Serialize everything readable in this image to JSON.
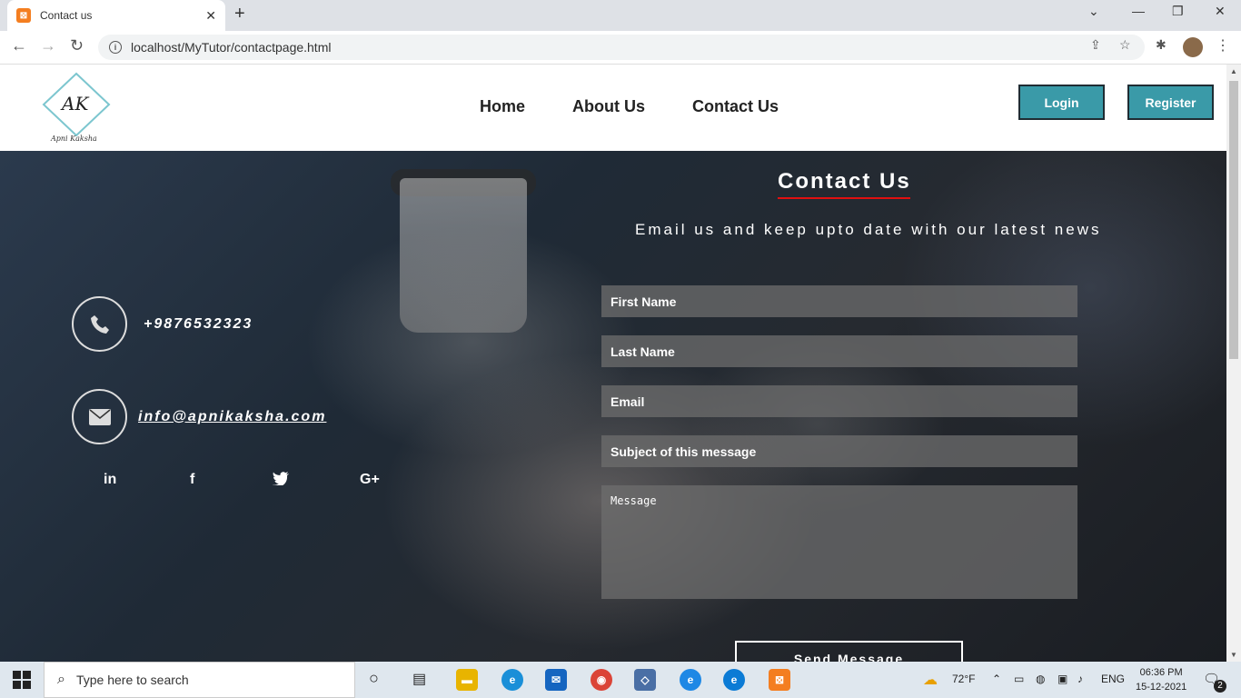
{
  "browser": {
    "tab_title": "Contact us",
    "url": "localhost/MyTutor/contactpage.html"
  },
  "header": {
    "logo_text": "AK",
    "logo_caption": "Apni Kaksha",
    "nav": [
      "Home",
      "About Us",
      "Contact Us"
    ],
    "login_label": "Login",
    "register_label": "Register"
  },
  "contact": {
    "title": "Contact Us",
    "subtitle": "Email us and keep upto date with our latest news",
    "phone": "+9876532323",
    "email": "info@apnikaksha.com",
    "social": [
      "in",
      "f",
      "🐦",
      "G+"
    ]
  },
  "form": {
    "first_name": "First Name",
    "last_name": "Last Name",
    "email": "Email",
    "subject": "Subject of this message",
    "message": "Message",
    "send_label": "Send Message"
  },
  "taskbar": {
    "search_placeholder": "Type here to search",
    "weather": "72°F",
    "lang": "ENG",
    "time": "06:36 PM",
    "date": "15-12-2021",
    "notifications": "2"
  },
  "colors": {
    "accent": "#3a9aa8",
    "underline": "#e01010"
  }
}
